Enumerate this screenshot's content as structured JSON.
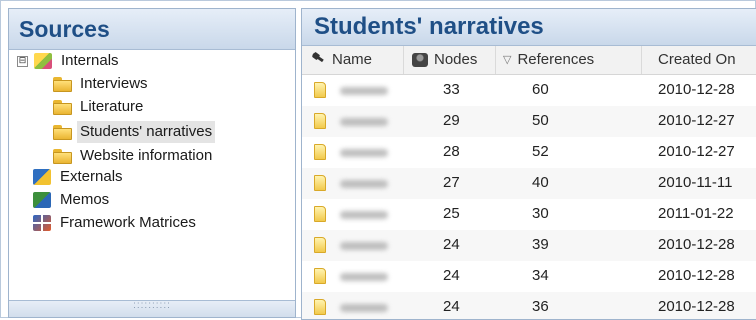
{
  "sources": {
    "title": "Sources",
    "tree": [
      {
        "label": "Internals",
        "expander": "⊟"
      },
      {
        "label": "Interviews"
      },
      {
        "label": "Literature"
      },
      {
        "label": "Students' narratives"
      },
      {
        "label": "Website information"
      },
      {
        "label": "Externals"
      },
      {
        "label": "Memos"
      },
      {
        "label": "Framework Matrices"
      }
    ],
    "splitter_grip": "::::::::::"
  },
  "list": {
    "title": "Students' narratives",
    "columns": {
      "name": "Name",
      "nodes": "Nodes",
      "sort_indicator": "▽",
      "references": "References",
      "created_on": "Created On"
    },
    "rows": [
      {
        "nodes": "33",
        "references": "60",
        "created_on": "2010-12-28"
      },
      {
        "nodes": "29",
        "references": "50",
        "created_on": "2010-12-27"
      },
      {
        "nodes": "28",
        "references": "52",
        "created_on": "2010-12-27"
      },
      {
        "nodes": "27",
        "references": "40",
        "created_on": "2010-11-11"
      },
      {
        "nodes": "25",
        "references": "30",
        "created_on": "2011-01-22"
      },
      {
        "nodes": "24",
        "references": "39",
        "created_on": "2010-12-28"
      },
      {
        "nodes": "24",
        "references": "34",
        "created_on": "2010-12-28"
      },
      {
        "nodes": "24",
        "references": "36",
        "created_on": "2010-12-28"
      }
    ]
  },
  "colors": {
    "header_text": "#1f4f86",
    "selection": "#e4e4e4"
  }
}
